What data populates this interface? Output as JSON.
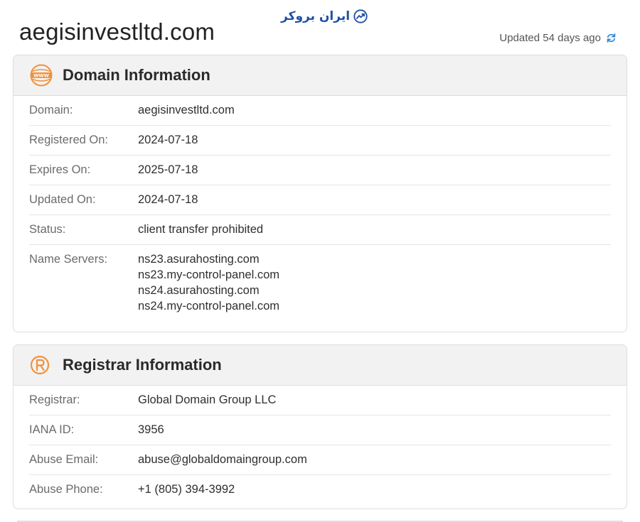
{
  "header": {
    "domain": "aegisinvestltd.com",
    "brand": "ایران بروکر",
    "updated": "Updated 54 days ago"
  },
  "domain_info": {
    "title": "Domain Information",
    "icon": "www-globe-icon",
    "rows": [
      {
        "label": "Domain:",
        "value": "aegisinvestltd.com"
      },
      {
        "label": "Registered On:",
        "value": "2024-07-18"
      },
      {
        "label": "Expires On:",
        "value": "2025-07-18"
      },
      {
        "label": "Updated On:",
        "value": "2024-07-18"
      },
      {
        "label": "Status:",
        "value": "client transfer prohibited"
      }
    ],
    "name_servers": {
      "label": "Name Servers:",
      "values": [
        "ns23.asurahosting.com",
        "ns23.my-control-panel.com",
        "ns24.asurahosting.com",
        "ns24.my-control-panel.com"
      ]
    }
  },
  "registrar_info": {
    "title": "Registrar Information",
    "icon": "registered-icon",
    "rows": [
      {
        "label": "Registrar:",
        "value": "Global Domain Group LLC"
      },
      {
        "label": "IANA ID:",
        "value": "3956"
      },
      {
        "label": "Abuse Email:",
        "value": "abuse@globaldomaingroup.com"
      },
      {
        "label": "Abuse Phone:",
        "value": "+1 (805) 394-3992"
      }
    ]
  },
  "colors": {
    "accent_orange": "#f0923e",
    "brand_blue": "#1e4fa3",
    "refresh_blue": "#2f86d6"
  }
}
